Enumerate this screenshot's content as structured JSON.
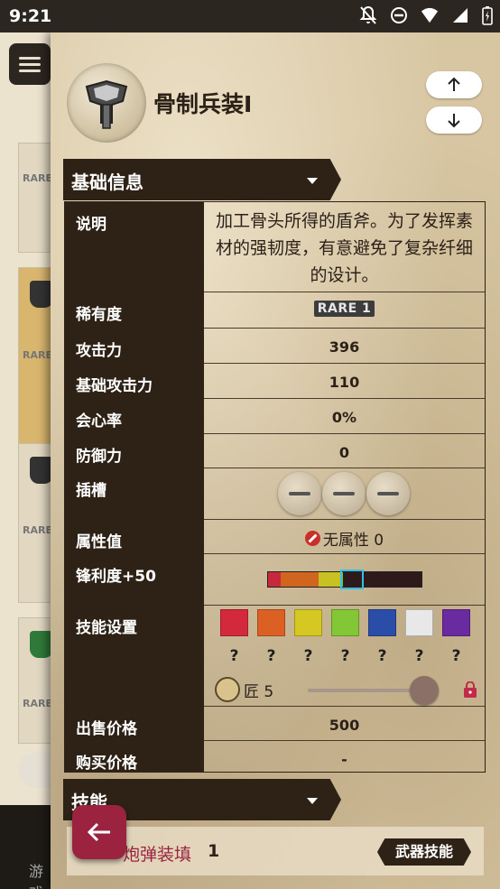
{
  "status_bar": {
    "time": "9:21",
    "icons": [
      "notifications-off-icon",
      "do-not-disturb-icon",
      "wifi-icon",
      "signal-icon",
      "battery-icon"
    ]
  },
  "background_app": {
    "cards": [
      {
        "rarity": "RARE"
      },
      {
        "rarity": "RARE"
      },
      {
        "rarity": "RARE"
      },
      {
        "rarity": "RARE"
      }
    ],
    "bottom_text": "游戏"
  },
  "weapon": {
    "name": "骨制兵装I",
    "icon": "charge-blade-icon"
  },
  "sections": {
    "basic_info": "基础信息",
    "skills": "技能"
  },
  "info": {
    "description_label": "说明",
    "description": "加工骨头所得的盾斧。为了发挥素材的强韧度，有意避免了复杂纤细的设计。",
    "rarity_label": "稀有度",
    "rarity": "RARE 1",
    "attack_label": "攻击力",
    "attack": "396",
    "base_attack_label": "基础攻击力",
    "base_attack": "110",
    "affinity_label": "会心率",
    "affinity": "0%",
    "defense_label": "防御力",
    "defense": "0",
    "slots_label": "插槽",
    "element_label": "属性值",
    "element": "无属性 0",
    "sharpness_label": "锋利度+50",
    "skill_setting_label": "技能设置",
    "craft_label": "匠 5",
    "sell_label": "出售价格",
    "sell": "500",
    "buy_label": "购买价格",
    "buy": "-"
  },
  "sharpness": {
    "segments": [
      {
        "color": "#c8283c",
        "value": 0.08
      },
      {
        "color": "#d0651e",
        "value": 0.25
      },
      {
        "color": "#c9c021",
        "value": 0.14
      },
      {
        "color": "#7fc235",
        "value": 0.02
      },
      {
        "color": "#2e1a1a",
        "value": 0.51
      }
    ],
    "marker_start": 0.47,
    "marker_end": 0.62
  },
  "skill_colors": [
    "#d4283c",
    "#dc6023",
    "#d6c823",
    "#84c736",
    "#2a4ea8",
    "#e8e8e8",
    "#6a2aa0"
  ],
  "skill_question": [
    "?",
    "?",
    "?",
    "?",
    "?",
    "?",
    "?"
  ],
  "weapon_skill": {
    "name": "炮弹装填",
    "level": "1",
    "tag": "武器技能"
  }
}
